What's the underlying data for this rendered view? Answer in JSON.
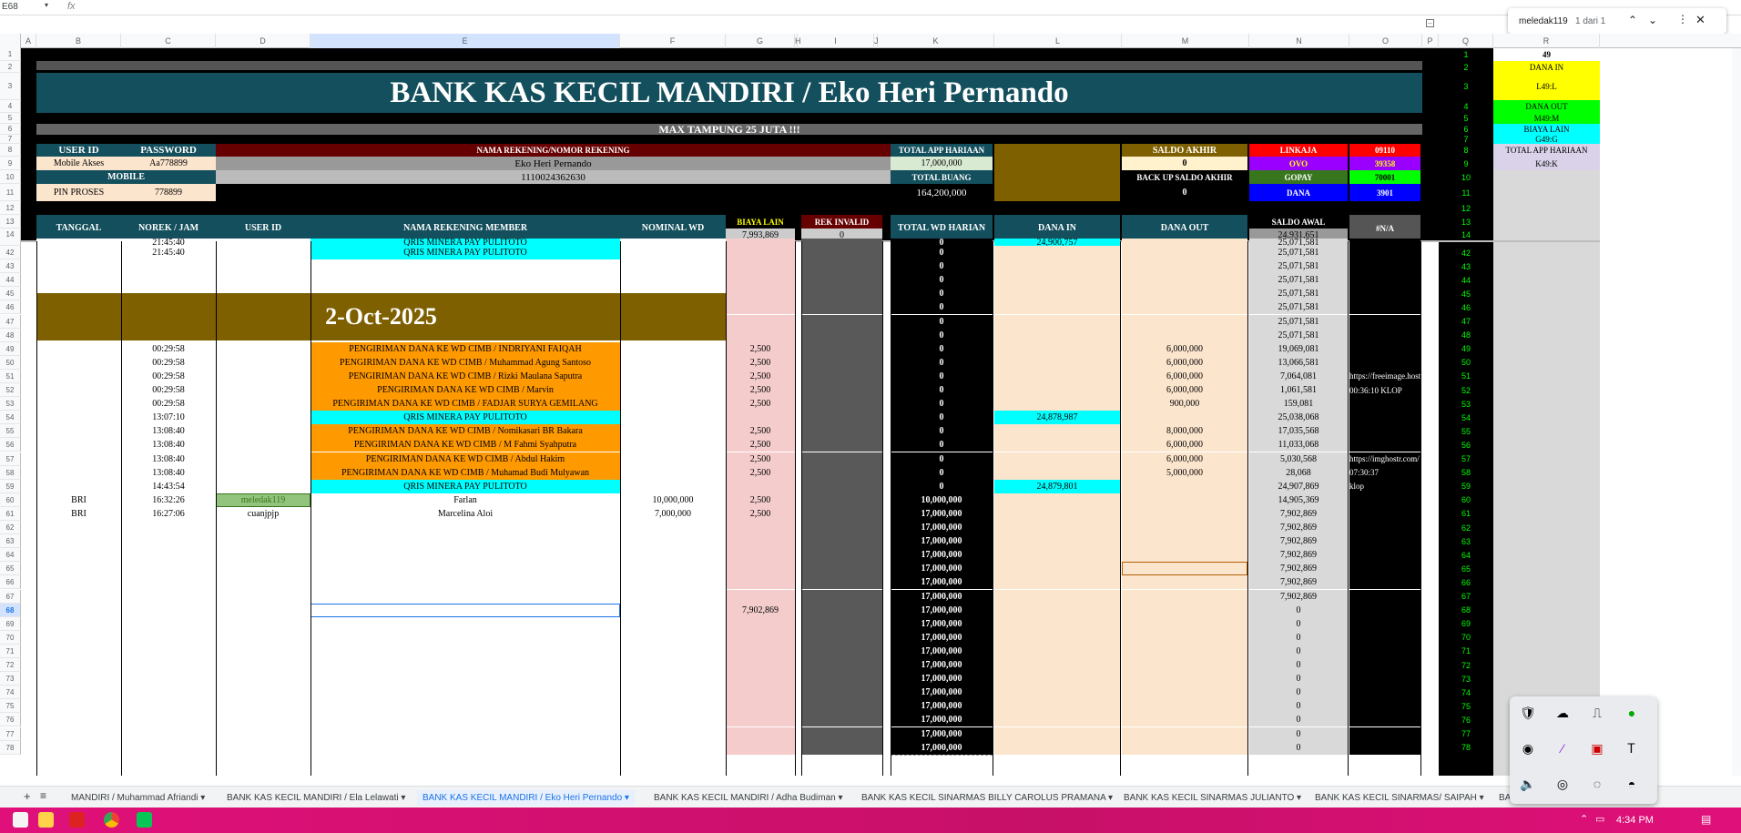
{
  "namebox": "E68",
  "fx": "fx",
  "find": {
    "query": "meledak119",
    "count": "1 dari 1"
  },
  "columns": [
    "A",
    "B",
    "C",
    "D",
    "E",
    "F",
    "G",
    "H",
    "I",
    "J",
    "K",
    "L",
    "M",
    "N",
    "O",
    "P",
    "Q",
    "R"
  ],
  "header": {
    "title": "BANK KAS KECIL MANDIRI / Eko Heri Pernando",
    "subtitle": "MAX TAMPUNG 25 JUTA !!!",
    "user_id_label": "USER ID",
    "password_label": "PASSWORD",
    "mobile_akses": "Mobile Akses",
    "password": "Aa778899",
    "mobile_label": "MOBILE",
    "pin_label": "PIN PROSES",
    "pin": "778899",
    "nama_rek_label": "NAMA REKENING/NOMOR REKENING",
    "nama_rek": "Eko Heri Pernando",
    "no_rek": "1110024362630",
    "total_app_label": "TOTAL APP HARIAAN",
    "total_app": "17,000,000",
    "total_buang_label": "TOTAL BUANG",
    "total_buang": "164,200,000",
    "saldo_akhir_label": "SALDO AKHIR",
    "saldo_akhir": "0",
    "backup_label": "BACK UP SALDO AKHIR",
    "backup": "0",
    "wallets": [
      {
        "name": "LINKAJA",
        "code": "09110"
      },
      {
        "name": "OVO",
        "code": "39358"
      },
      {
        "name": "GOPAY",
        "code": "70001"
      },
      {
        "name": "DANA",
        "code": "3901"
      }
    ]
  },
  "table_headers": {
    "tanggal": "TANGGAL",
    "norek": "NOREK / JAM",
    "userid": "USER ID",
    "nama": "NAMA REKENING MEMBER",
    "nominal": "NOMINAL WD",
    "biaya_label": "BIAYA LAIN",
    "biaya_total": "7,993,869",
    "rek_invalid_label": "REK INVALID",
    "rek_invalid": "0",
    "total_wd": "TOTAL WD HARIAN",
    "dana_in": "DANA IN",
    "dana_out": "DANA OUT",
    "saldo_awal_label": "SALDO AWAL",
    "saldo_awal": "24,931,651",
    "na": "#N/A"
  },
  "date_banner": "2-Oct-2025",
  "side_panel": [
    {
      "row": "1",
      "text": "49",
      "color": "#ffffff"
    },
    {
      "row": "2",
      "text": "DANA IN",
      "color": "#ffff00"
    },
    {
      "row": "3",
      "text": "L49:L",
      "color": "#ffff00"
    },
    {
      "row": "4",
      "text": "DANA OUT",
      "color": "#00ff00"
    },
    {
      "row": "5",
      "text": "M49:M",
      "color": "#00ff00"
    },
    {
      "row": "6",
      "text": "BIAYA LAIN",
      "color": "#00ffff"
    },
    {
      "row": "7",
      "text": "G49:G",
      "color": "#00ffff"
    },
    {
      "row": "8",
      "text": "TOTAL APP HARIAAN",
      "color": "#d9d2e9"
    },
    {
      "row": "9",
      "text": "K49:K",
      "color": "#d9d2e9"
    }
  ],
  "rows": [
    {
      "n": "41",
      "jam": "21:45:40",
      "nama": "QRIS MINERA PAY PULITOTO",
      "namaBg": "cyan",
      "twd": "0",
      "din": "24,900,757",
      "saldo": "25,071,581",
      "q": "41"
    },
    {
      "n": "42",
      "jam": "21:45:40",
      "nama": "QRIS MINERA PAY PULITOTO",
      "namaBg": "cyan",
      "twd": "0",
      "saldo": "25,071,581",
      "q": "42"
    },
    {
      "n": "43",
      "twd": "0",
      "saldo": "25,071,581",
      "q": "43"
    },
    {
      "n": "44",
      "twd": "0",
      "saldo": "25,071,581",
      "q": "44"
    },
    {
      "n": "45",
      "twd": "0",
      "saldo": "25,071,581",
      "q": "45"
    },
    {
      "n": "46",
      "twd": "0",
      "saldo": "25,071,581",
      "q": "46",
      "banner": true
    },
    {
      "n": "47",
      "twd": "0",
      "saldo": "25,071,581",
      "q": "47",
      "banner": true
    },
    {
      "n": "48",
      "twd": "0",
      "saldo": "25,071,581",
      "q": "48",
      "banner": true
    },
    {
      "n": "49",
      "jam": "00:29:58",
      "nama": "PENGIRIMAN DANA KE WD CIMB / INDRIYANI FAIQAH",
      "namaBg": "orange",
      "biaya": "2,500",
      "twd": "0",
      "dout": "6,000,000",
      "saldo": "19,069,081",
      "q": "49"
    },
    {
      "n": "50",
      "jam": "00:29:58",
      "nama": "PENGIRIMAN DANA KE WD CIMB / Muhammad Agung Santoso",
      "namaBg": "orange",
      "biaya": "2,500",
      "twd": "0",
      "dout": "6,000,000",
      "saldo": "13,066,581",
      "q": "50"
    },
    {
      "n": "51",
      "jam": "00:29:58",
      "nama": "PENGIRIMAN DANA KE WD CIMB / Rizki Maulana Saputra",
      "namaBg": "orange",
      "biaya": "2,500",
      "twd": "0",
      "dout": "6,000,000",
      "saldo": "7,064,081",
      "o": "https://freeimage.host",
      "q": "51"
    },
    {
      "n": "52",
      "jam": "00:29:58",
      "nama": "PENGIRIMAN DANA KE WD CIMB / Marvin",
      "namaBg": "orange",
      "biaya": "2,500",
      "twd": "0",
      "dout": "6,000,000",
      "saldo": "1,061,581",
      "o": "00:36:10 KLOP",
      "q": "52"
    },
    {
      "n": "53",
      "jam": "00:29:58",
      "nama": "PENGIRIMAN DANA KE WD CIMB / FADJAR SURYA GEMILANG",
      "namaBg": "orange",
      "biaya": "2,500",
      "twd": "0",
      "dout": "900,000",
      "saldo": "159,081",
      "q": "53"
    },
    {
      "n": "54",
      "jam": "13:07:10",
      "nama": "QRIS MINERA PAY PULITOTO",
      "namaBg": "cyan",
      "twd": "0",
      "din": "24,878,987",
      "saldo": "25,038,068",
      "q": "54"
    },
    {
      "n": "55",
      "jam": "13:08:40",
      "nama": "PENGIRIMAN DANA KE WD CIMB / Nomikasari BR Bakara",
      "namaBg": "orange",
      "biaya": "2,500",
      "twd": "0",
      "dout": "8,000,000",
      "saldo": "17,035,568",
      "q": "55"
    },
    {
      "n": "56",
      "jam": "13:08:40",
      "nama": "PENGIRIMAN DANA KE WD CIMB / M Fahmi Syahputra",
      "namaBg": "orange",
      "biaya": "2,500",
      "twd": "0",
      "dout": "6,000,000",
      "saldo": "11,033,068",
      "q": "56"
    },
    {
      "n": "57",
      "jam": "13:08:40",
      "nama": "PENGIRIMAN DANA KE WD CIMB / Abdul Hakim",
      "namaBg": "orange",
      "biaya": "2,500",
      "twd": "0",
      "dout": "6,000,000",
      "saldo": "5,030,568",
      "o": "https://imghostr.com/",
      "q": "57"
    },
    {
      "n": "58",
      "jam": "13:08:40",
      "nama": "PENGIRIMAN DANA KE WD CIMB / Muhamad Budi Mulyawan",
      "namaBg": "orange",
      "biaya": "2,500",
      "twd": "0",
      "dout": "5,000,000",
      "saldo": "28,068",
      "o": "07:30:37",
      "q": "58"
    },
    {
      "n": "59",
      "jam": "14:43:54",
      "nama": "QRIS MINERA PAY PULITOTO",
      "namaBg": "cyan",
      "twd": "0",
      "din": "24,879,801",
      "saldo": "24,907,869",
      "o": "klop",
      "q": "59"
    },
    {
      "n": "60",
      "tgl": "BRI",
      "jam": "16:32:26",
      "uid": "meledak119",
      "uidHl": true,
      "nama": "Farlan",
      "nominal": "10,000,000",
      "biaya": "2,500",
      "twd": "10,000,000",
      "saldo": "14,905,369",
      "q": "60"
    },
    {
      "n": "61",
      "tgl": "BRI",
      "jam": "16:27:06",
      "uid": "cuanjpjp",
      "nama": "Marcelina Aloi",
      "nominal": "7,000,000",
      "biaya": "2,500",
      "twd": "17,000,000",
      "saldo": "7,902,869",
      "q": "61"
    },
    {
      "n": "62",
      "twd": "17,000,000",
      "saldo": "7,902,869",
      "q": "62"
    },
    {
      "n": "63",
      "twd": "17,000,000",
      "saldo": "7,902,869",
      "q": "63"
    },
    {
      "n": "64",
      "twd": "17,000,000",
      "saldo": "7,902,869",
      "q": "64"
    },
    {
      "n": "65",
      "twd": "17,000,000",
      "saldo": "7,902,869",
      "q": "65"
    },
    {
      "n": "66",
      "twd": "17,000,000",
      "saldo": "7,902,869",
      "q": "66"
    },
    {
      "n": "67",
      "twd": "17,000,000",
      "saldo": "7,902,869",
      "q": "67"
    },
    {
      "n": "68",
      "biaya": "7,902,869",
      "twd": "17,000,000",
      "saldo": "0",
      "q": "68",
      "selected": true
    },
    {
      "n": "69",
      "twd": "17,000,000",
      "saldo": "0",
      "q": "69"
    },
    {
      "n": "70",
      "twd": "17,000,000",
      "saldo": "0",
      "q": "70"
    },
    {
      "n": "71",
      "twd": "17,000,000",
      "saldo": "0",
      "q": "71"
    },
    {
      "n": "72",
      "twd": "17,000,000",
      "saldo": "0",
      "q": "72"
    },
    {
      "n": "73",
      "twd": "17,000,000",
      "saldo": "0",
      "q": "73"
    },
    {
      "n": "74",
      "twd": "17,000,000",
      "saldo": "0",
      "q": "74"
    },
    {
      "n": "75",
      "twd": "17,000,000",
      "saldo": "0",
      "q": "75"
    },
    {
      "n": "76",
      "twd": "17,000,000",
      "saldo": "0",
      "q": "76"
    },
    {
      "n": "77",
      "twd": "17,000,000",
      "saldo": "0",
      "q": "77"
    },
    {
      "n": "78",
      "twd": "17,000,000",
      "saldo": "0",
      "q": "78"
    }
  ],
  "tabs": [
    "MANDIRI / Muhammad Afriandi",
    "BANK KAS KECIL MANDIRI / Ela Lelawati",
    "BANK KAS KECIL MANDIRI / Eko Heri Pernando",
    "BANK KAS KECIL MANDIRI / Adha Budiman",
    "BANK KAS KECIL SINARMAS BILLY CAROLUS PRAMANA",
    "BANK KAS KECIL SINARMAS JULIANTO",
    "BANK KAS KECIL SINARMAS/ SAIPAH",
    "BA"
  ],
  "active_tab": 2,
  "clock": "4:34 PM"
}
